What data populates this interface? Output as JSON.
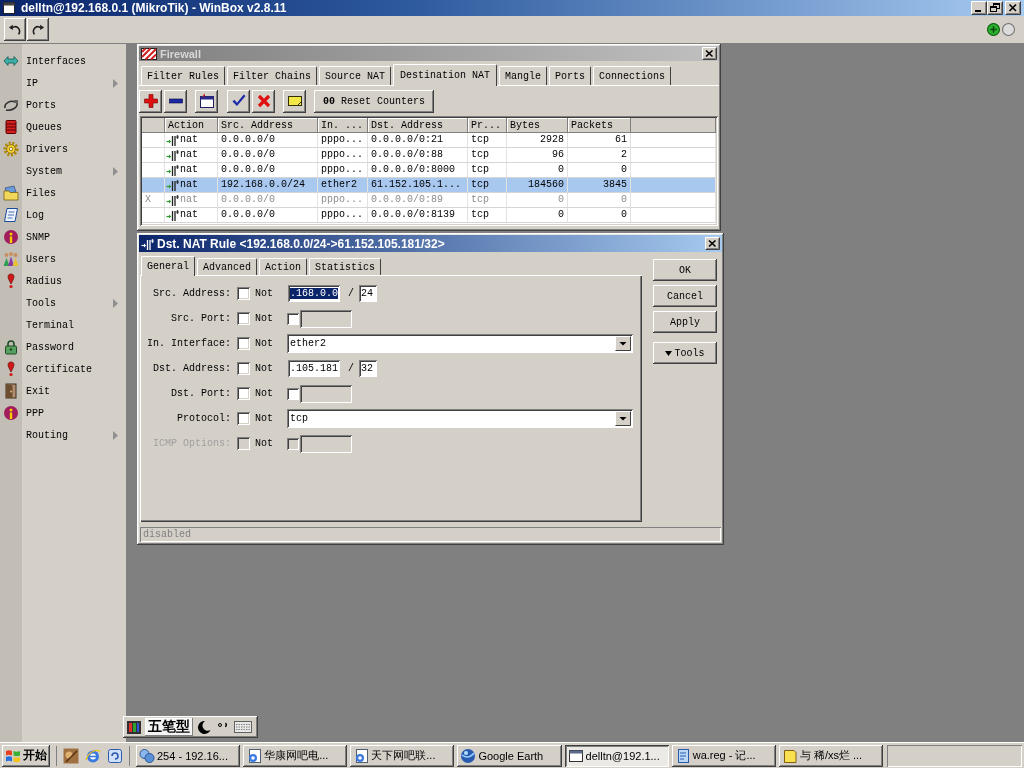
{
  "window": {
    "title": "delltn@192.168.0.1 (MikroTik) - WinBox v2.8.11"
  },
  "sidebar": {
    "items": [
      {
        "label": "Interfaces",
        "submenu": false
      },
      {
        "label": "IP",
        "submenu": true
      },
      {
        "label": "Ports",
        "submenu": false
      },
      {
        "label": "Queues",
        "submenu": false
      },
      {
        "label": "Drivers",
        "submenu": false
      },
      {
        "label": "System",
        "submenu": true
      },
      {
        "label": "Files",
        "submenu": false
      },
      {
        "label": "Log",
        "submenu": false
      },
      {
        "label": "SNMP",
        "submenu": false
      },
      {
        "label": "Users",
        "submenu": false
      },
      {
        "label": "Radius",
        "submenu": false
      },
      {
        "label": "Tools",
        "submenu": true
      },
      {
        "label": "Terminal",
        "submenu": false
      },
      {
        "label": "Password",
        "submenu": false
      },
      {
        "label": "Certificate",
        "submenu": false
      },
      {
        "label": "Exit",
        "submenu": false
      },
      {
        "label": "PPP",
        "submenu": false
      },
      {
        "label": "Routing",
        "submenu": true
      }
    ]
  },
  "firewall": {
    "title": "Firewall",
    "tabs": [
      {
        "label": "Filter Rules",
        "selected": false
      },
      {
        "label": "Filter Chains",
        "selected": false
      },
      {
        "label": "Source NAT",
        "selected": false
      },
      {
        "label": "Destination NAT",
        "selected": true
      },
      {
        "label": "Mangle",
        "selected": false
      },
      {
        "label": "Ports",
        "selected": false
      },
      {
        "label": "Connections",
        "selected": false
      }
    ],
    "reset_counters": {
      "glyph": "00",
      "label": "Reset Counters"
    },
    "table": {
      "columns": [
        "Action",
        "Src. Address",
        "In. ...",
        "Dst. Address",
        "Pr...",
        "Bytes",
        "Packets"
      ],
      "rows": [
        {
          "cells": [
            "nat",
            "0.0.0.0/0",
            "pppo...",
            "0.0.0.0/0:21",
            "tcp",
            "2928",
            "61"
          ],
          "selected": false,
          "disabled": false
        },
        {
          "cells": [
            "nat",
            "0.0.0.0/0",
            "pppo...",
            "0.0.0.0/0:88",
            "tcp",
            "96",
            "2"
          ],
          "selected": false,
          "disabled": false
        },
        {
          "cells": [
            "nat",
            "0.0.0.0/0",
            "pppo...",
            "0.0.0.0/0:8000",
            "tcp",
            "0",
            "0"
          ],
          "selected": false,
          "disabled": false
        },
        {
          "cells": [
            "nat",
            "192.168.0.0/24",
            "ether2",
            "61.152.105.1...",
            "tcp",
            "184560",
            "3845"
          ],
          "selected": true,
          "disabled": false
        },
        {
          "flag": "X",
          "cells": [
            "nat",
            "0.0.0.0/0",
            "pppo...",
            "0.0.0.0/0:89",
            "tcp",
            "0",
            "0"
          ],
          "selected": false,
          "disabled": true
        },
        {
          "cells": [
            "nat",
            "0.0.0.0/0",
            "pppo...",
            "0.0.0.0/0:8139",
            "tcp",
            "0",
            "0"
          ],
          "selected": false,
          "disabled": false
        }
      ]
    }
  },
  "rule_dialog": {
    "title": "Dst. NAT Rule <192.168.0.0/24->61.152.105.181/32>",
    "tabs": [
      {
        "label": "General",
        "selected": true
      },
      {
        "label": "Advanced",
        "selected": false
      },
      {
        "label": "Action",
        "selected": false
      },
      {
        "label": "Statistics",
        "selected": false
      }
    ],
    "fields": [
      {
        "kind": "address",
        "label": "Src. Address:",
        "not_label": "Not",
        "not_checked": false,
        "disabled": false,
        "value": ".168.0.0",
        "value_selected": true,
        "separator": "/",
        "mask": "24"
      },
      {
        "kind": "port",
        "label": "Src. Port:",
        "not_label": "Not",
        "not_checked": false,
        "disabled": false,
        "checked": false
      },
      {
        "kind": "select",
        "label": "In. Interface:",
        "not_label": "Not",
        "not_checked": false,
        "disabled": false,
        "value": "ether2"
      },
      {
        "kind": "address",
        "label": "Dst. Address:",
        "not_label": "Not",
        "not_checked": false,
        "disabled": false,
        "value": ".105.181",
        "value_selected": false,
        "separator": "/",
        "mask": "32"
      },
      {
        "kind": "port",
        "label": "Dst. Port:",
        "not_label": "Not",
        "not_checked": false,
        "disabled": false,
        "checked": false
      },
      {
        "kind": "select",
        "label": "Protocol:",
        "not_label": "Not",
        "not_checked": false,
        "disabled": false,
        "value": "tcp"
      },
      {
        "kind": "port",
        "label": "ICMP Options:",
        "not_label": "Not",
        "not_checked": false,
        "disabled": true,
        "checked": false
      }
    ],
    "buttons": [
      "OK",
      "Cancel",
      "Apply"
    ],
    "tools_button": "Tools",
    "status": "disabled"
  },
  "ime_bar": {
    "mode": "五笔型"
  },
  "taskbar": {
    "start": "开始",
    "tasks": [
      {
        "label": "254 - 192.16...",
        "selected": false
      },
      {
        "label": "华康网吧电...",
        "selected": false
      },
      {
        "label": "天下网吧联...",
        "selected": false
      },
      {
        "label": "Google Earth",
        "selected": false
      },
      {
        "label": "delltn@192.1...",
        "selected": true
      },
      {
        "label": "wa.reg - 记...",
        "selected": false
      },
      {
        "label": "与 稀/xs烂 ...",
        "selected": false
      }
    ]
  }
}
